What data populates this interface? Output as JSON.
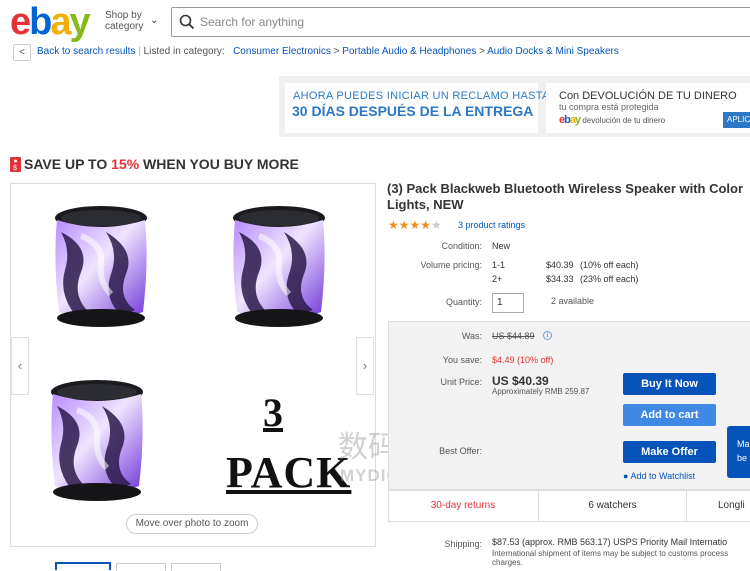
{
  "header": {
    "logo": [
      "e",
      "b",
      "a",
      "y"
    ],
    "shop_by": "Shop by category",
    "search_placeholder": "Search for anything"
  },
  "breadcrumb": {
    "back_label": "Back to search results",
    "listed_in": "Listed in category:",
    "items": [
      "Consumer Electronics",
      "Portable Audio & Headphones",
      "Audio Docks & Mini Speakers"
    ],
    "separator": ">"
  },
  "banners": {
    "left_line1": "AHORA PUEDES INICIAR UN RECLAMO HASTA",
    "left_line2": "30 DÍAS DESPUÉS DE LA ENTREGA",
    "right_line1": "Con DEVOLUCIÓN DE TU DINERO",
    "right_line2": "tu compra está protegida",
    "right_line3": "devolución de tu dinero",
    "right_button": "APLICA"
  },
  "promo": {
    "prefix": "SAVE UP TO ",
    "percent": "15%",
    "suffix": " WHEN YOU BUY MORE"
  },
  "gallery": {
    "zoom_hint": "Move over photo to zoom",
    "pack_number": "3",
    "pack_word": "PACK",
    "prev": "‹",
    "next": "›"
  },
  "watermark": {
    "line1": "数码之家",
    "line2": "MYDIGIT.NET"
  },
  "product": {
    "title": "(3) Pack Blackweb Bluetooth Wireless Speaker with Color Lights, NEW",
    "rating": 4,
    "rating_max": 5,
    "ratings_label": "3 product ratings",
    "condition_label": "Condition:",
    "condition": "New",
    "volume_label": "Volume pricing:",
    "volume": [
      {
        "qty": "1-1",
        "price": "$40.39",
        "note": "(10% off each)"
      },
      {
        "qty": "2+",
        "price": "$34.33",
        "note": "(23% off each)"
      }
    ],
    "quantity_label": "Quantity:",
    "quantity": "1",
    "available": "2 available"
  },
  "buybox": {
    "was_label": "Was:",
    "was_price": "US $44.89",
    "save_label": "You save:",
    "save_value": "$4.49 (10% off)",
    "unit_label": "Unit Price:",
    "unit_price": "US $40.39",
    "approx": "Approximately RMB 259.87",
    "buy_now": "Buy It Now",
    "add_to_cart": "Add to cart",
    "best_offer_label": "Best Offer:",
    "make_offer": "Make Offer",
    "tip": "Ma be",
    "watchlist": "Add to Watchlist"
  },
  "stats": {
    "returns": "30-day returns",
    "watchers": "6 watchers",
    "longest": "Longli"
  },
  "shipping": {
    "label": "Shipping:",
    "value": "$87.53 (approx. RMB 563.17) USPS Priority Mail Internatio",
    "note1": "International shipment of items may be subject to customs process",
    "note2": "charges."
  },
  "colors": {
    "accent_red": "#e53238",
    "link_blue": "#0654ba",
    "button_blue": "#0654ba",
    "cart_blue": "#3f89e4",
    "star_orange": "#f18c1c"
  }
}
